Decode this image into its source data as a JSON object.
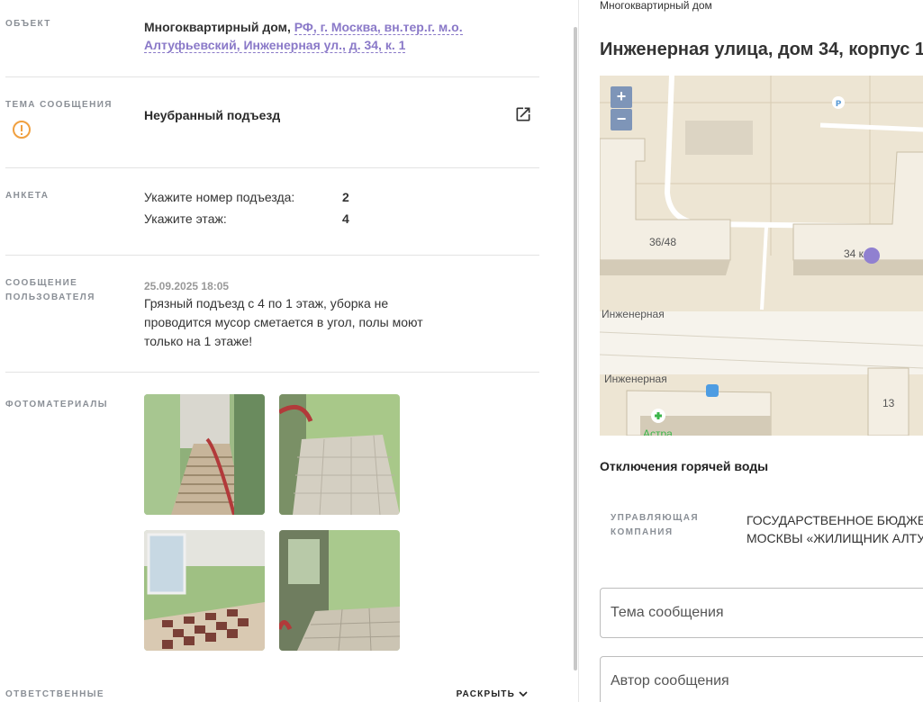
{
  "left": {
    "object": {
      "label": "ОБЪЕКТ",
      "title": "Многоквартирный дом,",
      "address": "РФ, г. Москва, вн.тер.г. м.о. Алтуфьевский, Инженерная ул., д. 34, к. 1"
    },
    "topic": {
      "label": "ТЕМА СООБЩЕНИЯ",
      "value": "Неубранный подъезд"
    },
    "survey": {
      "label": "АНКЕТА",
      "rows": [
        {
          "question": "Укажите номер подъезда:",
          "answer": "2"
        },
        {
          "question": "Укажите этаж:",
          "answer": "4"
        }
      ]
    },
    "message": {
      "label": "СООБЩЕНИЕ ПОЛЬЗОВАТЕЛЯ",
      "date": "25.09.2025 18:05",
      "text": "Грязный подъезд с 4 по 1 этаж, уборка не проводится мусор сметается в угол, полы моют только на 1 этаже!"
    },
    "photos": {
      "label": "ФОТОМАТЕРИАЛЫ"
    },
    "responsible": {
      "label": "ОТВЕТСТВЕННЫЕ",
      "expand": "РАСКРЫТЬ"
    }
  },
  "right": {
    "subtitle": "Многоквартирный дом",
    "title": "Инженерная улица, дом 34, корпус 1",
    "map": {
      "zoom_in": "+",
      "zoom_out": "−",
      "labels": {
        "b1": "36/48",
        "b2": "34 к",
        "street1": "Инженерная",
        "street2": "Инженерная",
        "b3": "13",
        "poi": "Астра"
      }
    },
    "section": "Отключения горячей воды",
    "management": {
      "label": "УПРАВЛЯЮЩАЯ КОМПАНИЯ",
      "line1": "ГОСУДАРСТВЕННОЕ БЮДЖЕТН",
      "line2": "МОСКВЫ «ЖИЛИЩНИК АЛТУФ"
    },
    "fields": {
      "topic_placeholder": "Тема сообщения",
      "author_placeholder": "Автор сообщения"
    }
  },
  "colors": {
    "accent": "#8a79c8",
    "warning": "#f0a040",
    "map_bg": "#ede5d3",
    "map_marker": "#9080d0"
  },
  "icons": {
    "warning": "warning-circle-icon",
    "external": "open-external-icon",
    "chevron": "chevron-down-icon"
  }
}
